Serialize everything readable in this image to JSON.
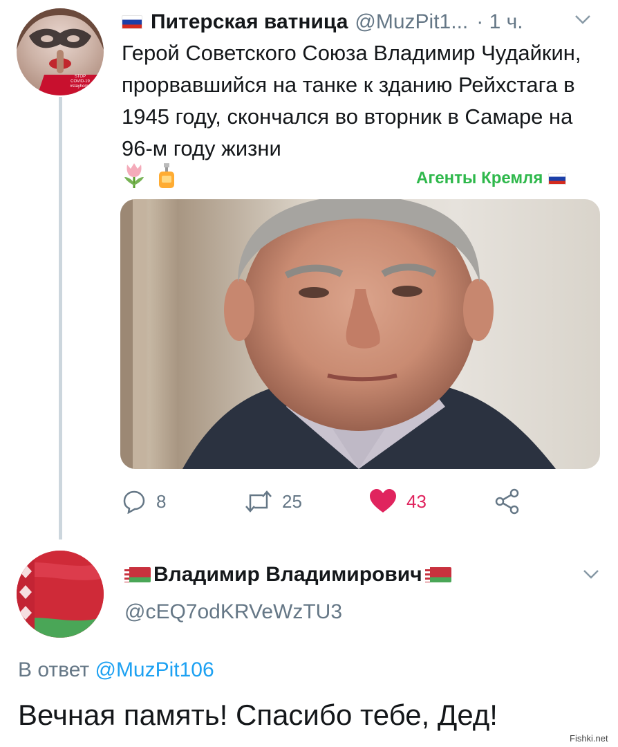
{
  "tweet": {
    "author_name": "Питерская ватница",
    "author_handle": "@MuzPit1...",
    "time": "· 1 ч.",
    "text": "Герой Советского Союза Владимир Чудайкин, прорвавшийся на танке к зданию Рейхстага в 1945 году, скончался во вторник в Самаре на 96-м году жизни",
    "emojis": [
      "tulip-icon",
      "lotion-bottle-icon"
    ],
    "tag": "Агенты Кремля",
    "avatar_badge": [
      "STOP",
      "COVID-19",
      "#stayhome"
    ],
    "actions": {
      "replies": "8",
      "retweets": "25",
      "likes": "43"
    },
    "colors": {
      "text": "#14171a",
      "muted": "#657786",
      "like": "#e0245e",
      "tag_green": "#2eb84b",
      "thread_line": "#ccd6dd"
    }
  },
  "reply": {
    "author_name": "Владимир Владимирович",
    "author_handle": "@cEQ7odKRVeWzTU3",
    "reply_to_prefix": "В ответ",
    "reply_to_handle": "@MuzPit106",
    "text": "Вечная память! Спасибо тебе, Дед!",
    "colors": {
      "link": "#1da1f2"
    }
  },
  "watermark": "Fishki.net"
}
